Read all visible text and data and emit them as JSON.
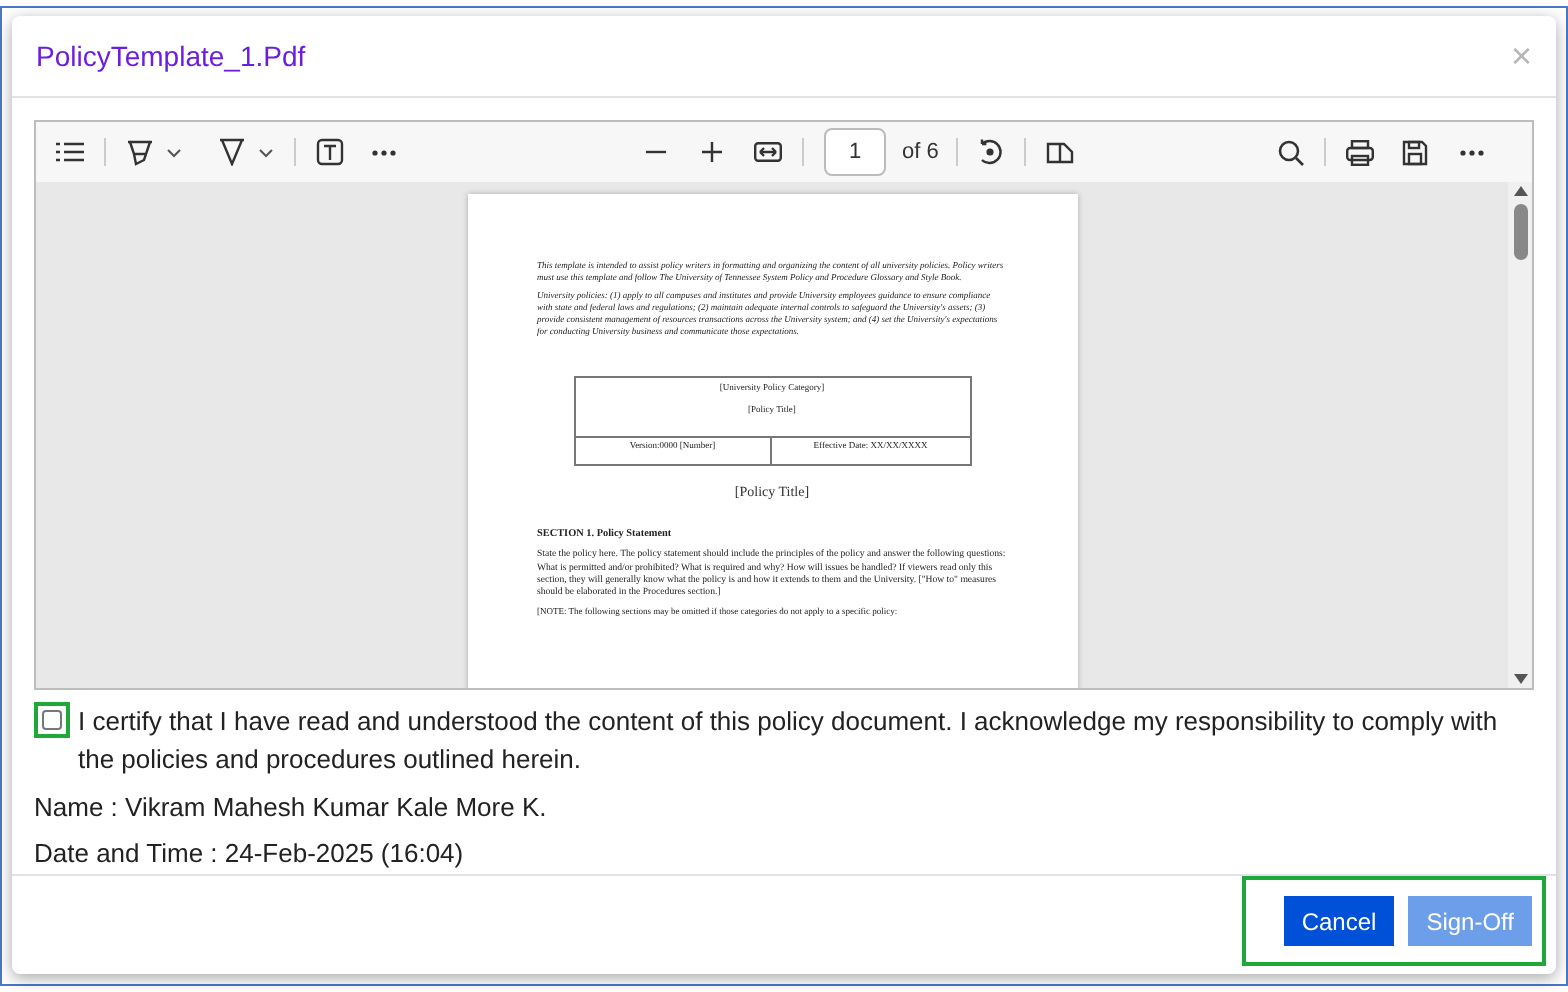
{
  "dialog": {
    "title": "PolicyTemplate_1.Pdf",
    "close": "×"
  },
  "viewer": {
    "page_number": "1",
    "page_count": "of 6",
    "document": {
      "intro": [
        "This template is intended to assist policy writers in formatting and organizing the content of all university policies. Policy writers must use this template and follow The University of Tennessee System Policy and Procedure Glossary and Style Book.",
        "University policies: (1) apply to all campuses and institutes and provide University employees guidance to ensure compliance with state and federal laws and regulations; (2) maintain adequate internal controls to safeguard the University's assets; (3) provide consistent management of resources transactions across the University system; and (4) set the University's expectations for conducting University business and communicate those expectations."
      ],
      "table": {
        "category": "[University Policy Category]",
        "title": "[Policy Title]",
        "version": "Version:0000 [Number]",
        "effective_date": "Effective Date: XX/XX/XXXX"
      },
      "policy_title": "[Policy Title]",
      "section_heading": "SECTION 1.  Policy Statement",
      "section_text": "State the policy here.  The policy statement should include the principles of the policy and answer the following questions: What is permitted and/or prohibited? What is required and why? How will issues be handled?  If viewers read only this section, they will generally know what the policy is and how it extends to them and the University.  [\"How to\" measures should be elaborated in the Procedures section.]",
      "note": "[NOTE: The following sections may be omitted if those categories do not apply to a specific policy:"
    }
  },
  "certification": {
    "text": "I certify that I have read and understood the content of this policy document. I acknowledge my responsibility to comply with the policies and procedures outlined herein.",
    "checked": false
  },
  "name": "Name : Vikram Mahesh Kumar Kale More K.",
  "date_time": "Date and Time : 24-Feb-2025 (16:04)",
  "buttons": [
    {
      "label": "Cancel",
      "kind": "primary",
      "disabled": false
    },
    {
      "label": "Sign-Off",
      "kind": "primary",
      "disabled": true
    }
  ]
}
